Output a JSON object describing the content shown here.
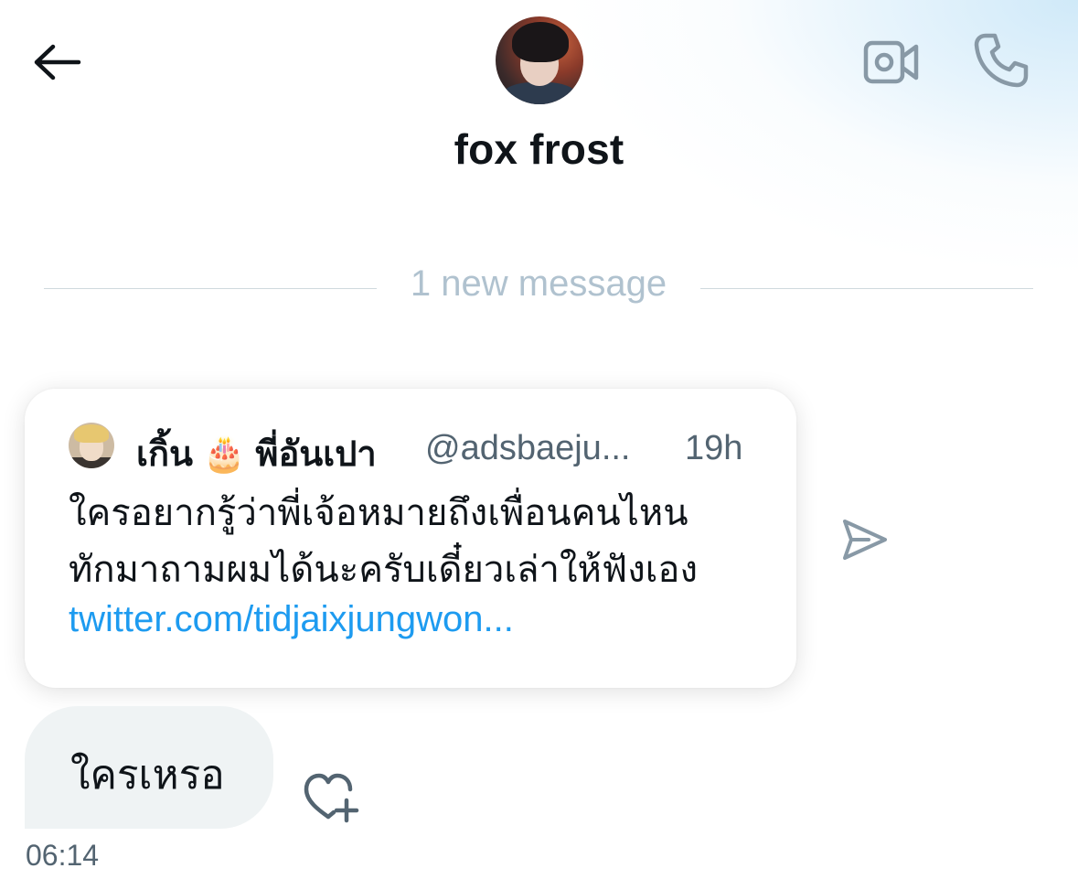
{
  "header": {
    "title": "fox frost",
    "back_icon": "arrow-left-icon",
    "video_icon": "video-camera-icon",
    "phone_icon": "phone-icon"
  },
  "divider": {
    "label": "1 new message"
  },
  "shared_tweet": {
    "author_name": "เกิ้น 🎂 พี่อันเปา",
    "author_handle": "@adsbaeju...",
    "time": "19h",
    "text_line1": "ใครอยากรู้ว่าพี่เจ้อหมายถึงเพื่อนคนไหน",
    "text_line2": "ทักมาถามผมได้นะครับเดี๋ยวเล่าให้ฟังเอง",
    "link": "twitter.com/tidjaixjungwon..."
  },
  "message": {
    "text": "ใครเหรอ",
    "time": "06:14"
  },
  "colors": {
    "accent_link": "#1d9bf0",
    "icon_gray": "#8899a6",
    "bubble_bg": "#eff3f4",
    "divider_text": "#b0c2cf"
  }
}
